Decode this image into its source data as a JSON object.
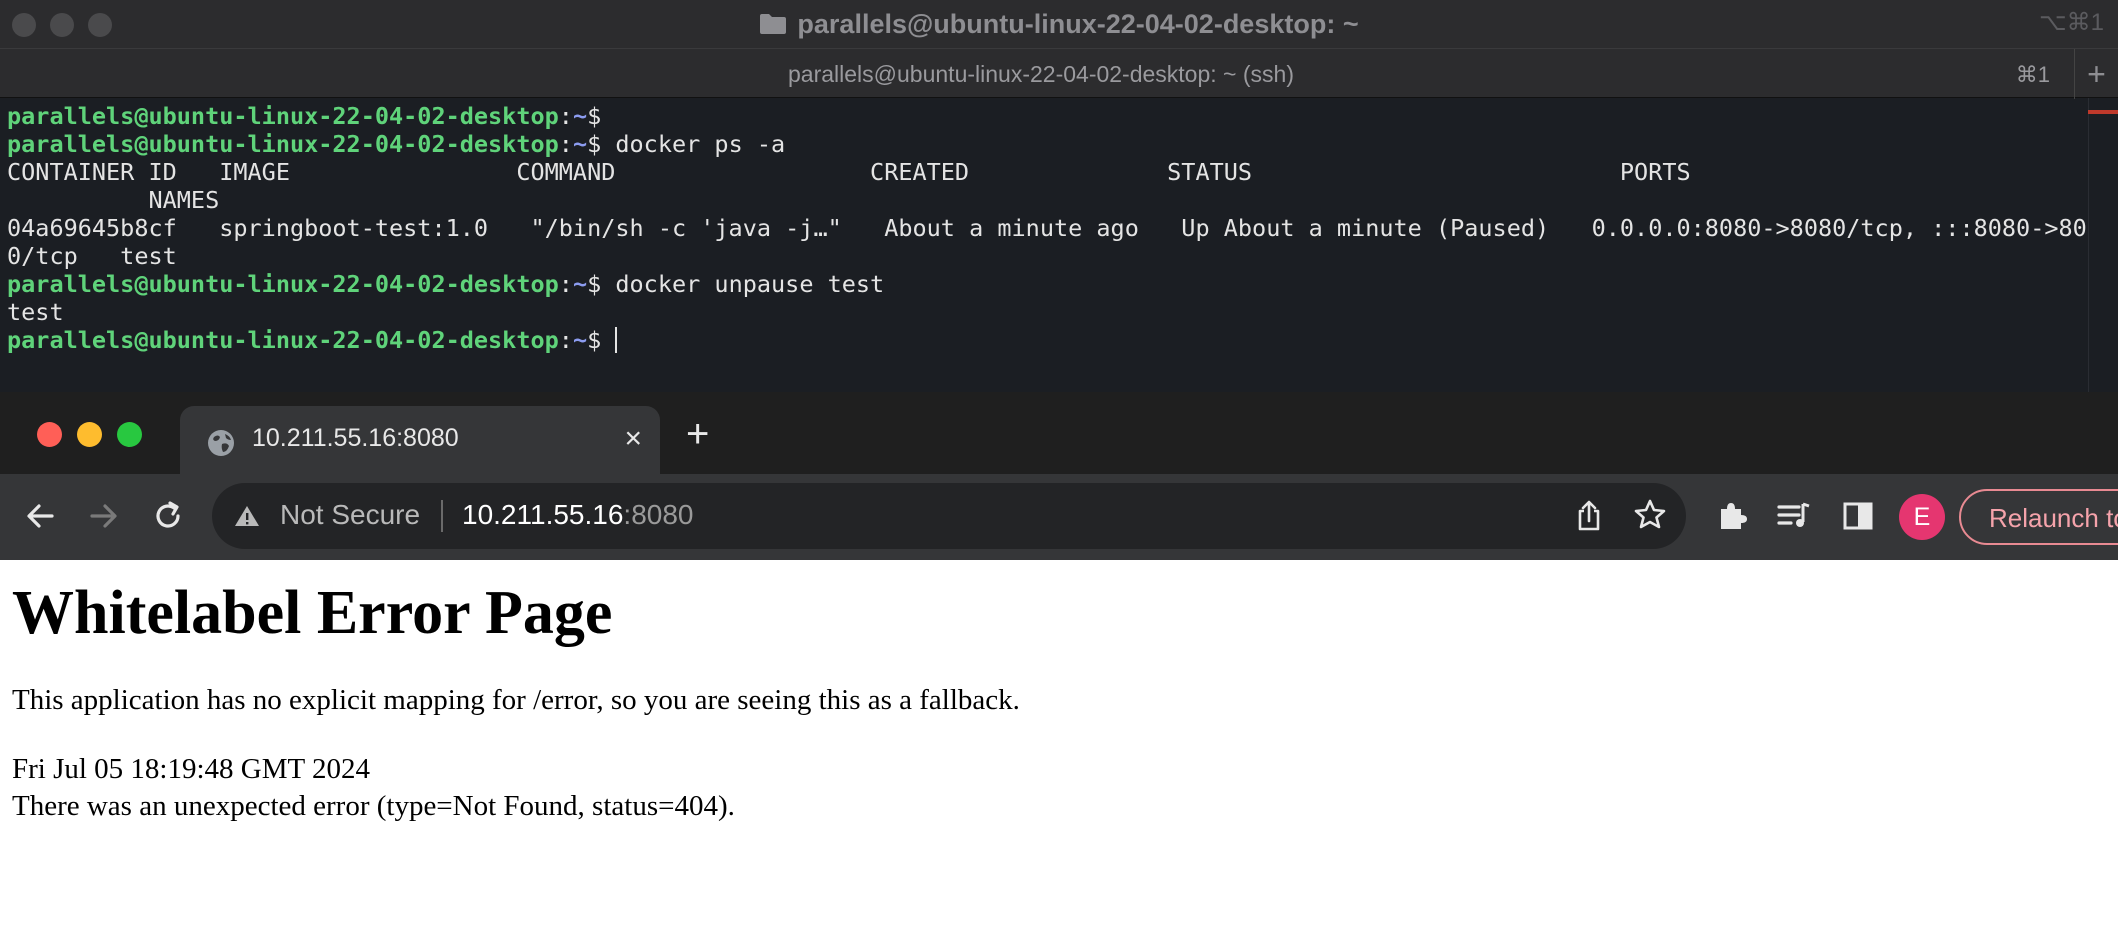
{
  "terminal": {
    "window_title": "parallels@ubuntu-linux-22-04-02-desktop: ~",
    "window_shortcut": "⌥⌘1",
    "tab_title": "parallels@ubuntu-linux-22-04-02-desktop: ~ (ssh)",
    "tab_shortcut": "⌘1",
    "new_tab_label": "+",
    "prompt": {
      "user_host": "parallels@ubuntu-linux-22-04-02-desktop",
      "colon": ":",
      "path": "~",
      "symbol": "$ "
    },
    "lines": [
      {
        "kind": "prompt",
        "command": ""
      },
      {
        "kind": "prompt",
        "command": "docker ps -a"
      },
      {
        "kind": "output",
        "text": "CONTAINER ID   IMAGE                COMMAND                  CREATED              STATUS                          PORTS"
      },
      {
        "kind": "output",
        "text": "          NAMES"
      },
      {
        "kind": "output",
        "text": "04a69645b8cf   springboot-test:1.0   \"/bin/sh -c 'java -j…\"   About a minute ago   Up About a minute (Paused)   0.0.0.0:8080->8080/tcp, :::8080->808"
      },
      {
        "kind": "output",
        "text": "0/tcp   test"
      },
      {
        "kind": "prompt",
        "command": "docker unpause test"
      },
      {
        "kind": "output",
        "text": "test"
      },
      {
        "kind": "prompt",
        "command": "",
        "cursor": true
      }
    ]
  },
  "browser": {
    "tab": {
      "title": "10.211.55.16:8080",
      "close": "×"
    },
    "new_tab": "+",
    "omnibox": {
      "security_label": "Not Secure",
      "host": "10.211.55.16",
      "port": ":8080"
    },
    "profile_initial": "E",
    "relaunch_label": "Relaunch to update",
    "page": {
      "title": "Whitelabel Error Page",
      "description": "This application has no explicit mapping for /error, so you are seeing this as a fallback.",
      "timestamp": "Fri Jul 05 18:19:48 GMT 2024",
      "message": "There was an unexpected error (type=Not Found, status=404)."
    }
  },
  "colors": {
    "prompt_user": "#5fd37a",
    "prompt_path": "#8c9cf0",
    "terminal_bg": "#1b1e23",
    "avatar": "#e53670",
    "traffic_close": "#ff5f57",
    "traffic_min": "#febc2e",
    "traffic_max": "#28c840"
  }
}
